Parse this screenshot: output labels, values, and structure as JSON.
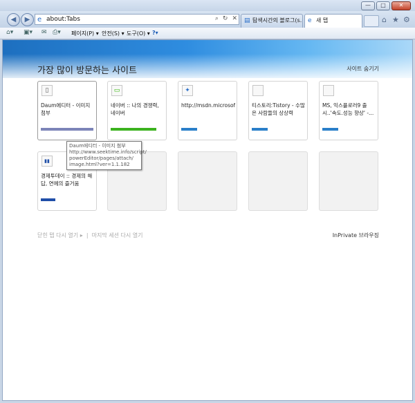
{
  "window": {
    "controls": {
      "minimize": "—",
      "maximize": "□",
      "close": "✕"
    }
  },
  "nav": {
    "back": "◀",
    "forward": "▶",
    "address": "about:Tabs",
    "search_icon": "⌕",
    "refresh_icon": "↻",
    "stop_icon": "✕"
  },
  "tabs": [
    {
      "label": "탐색시간의 블로그(s...",
      "active": false
    },
    {
      "label": "새 탭",
      "active": true
    }
  ],
  "toolbar_right": {
    "home": "⌂",
    "favorites": "★",
    "tools": "⚙"
  },
  "commandbar": {
    "page": "페이지(P) ▾",
    "safety": "안전(S) ▾",
    "tools": "도구(O) ▾",
    "help": "?▾"
  },
  "page": {
    "title": "가장 많이 방문하는 사이트",
    "hide_sites": "사이트 숨기기",
    "reopen_closed": "닫힌 탭 다시 열기 ▸",
    "separator": "|",
    "reopen_session": "마지막 세션 다시 열기",
    "inprivate": "InPrivate 브라우징"
  },
  "tiles": [
    {
      "title": "Daum에디터 - 이미지 첨부",
      "favicon": "▯",
      "bar_fraction": 0.97,
      "bar_color": "#7c84b8"
    },
    {
      "title": "네이버 :: 나의 경쟁력, 네이버",
      "favicon": "▭",
      "bar_fraction": 0.85,
      "bar_color": "#3cb21f"
    },
    {
      "title": "http://msdn.microsoft.",
      "favicon": "✦",
      "bar_fraction": 0.29,
      "bar_color": "#2a7fc9"
    },
    {
      "title": "티스토리:Tistory - 수많은 사람들의 상상력",
      "favicon": "",
      "bar_fraction": 0.29,
      "bar_color": "#2a7fc9"
    },
    {
      "title": "MS, 익스플로러9 출시..'속도.성능 향상' -...",
      "favicon": "",
      "bar_fraction": 0.29,
      "bar_color": "#2a7fc9"
    },
    {
      "title": "경제투데이 :: 경제의 해답, 연예의 즐거움",
      "favicon": "▮▮",
      "bar_fraction": 0.27,
      "bar_color": "#1f4ea8"
    }
  ],
  "tooltip": {
    "lines": [
      "Daum에디터 - 이미지 첨부",
      "http://www.seektime.info/script/",
      "powerEditor/pages/attach/",
      "image.html?ver=1.1.182"
    ]
  }
}
